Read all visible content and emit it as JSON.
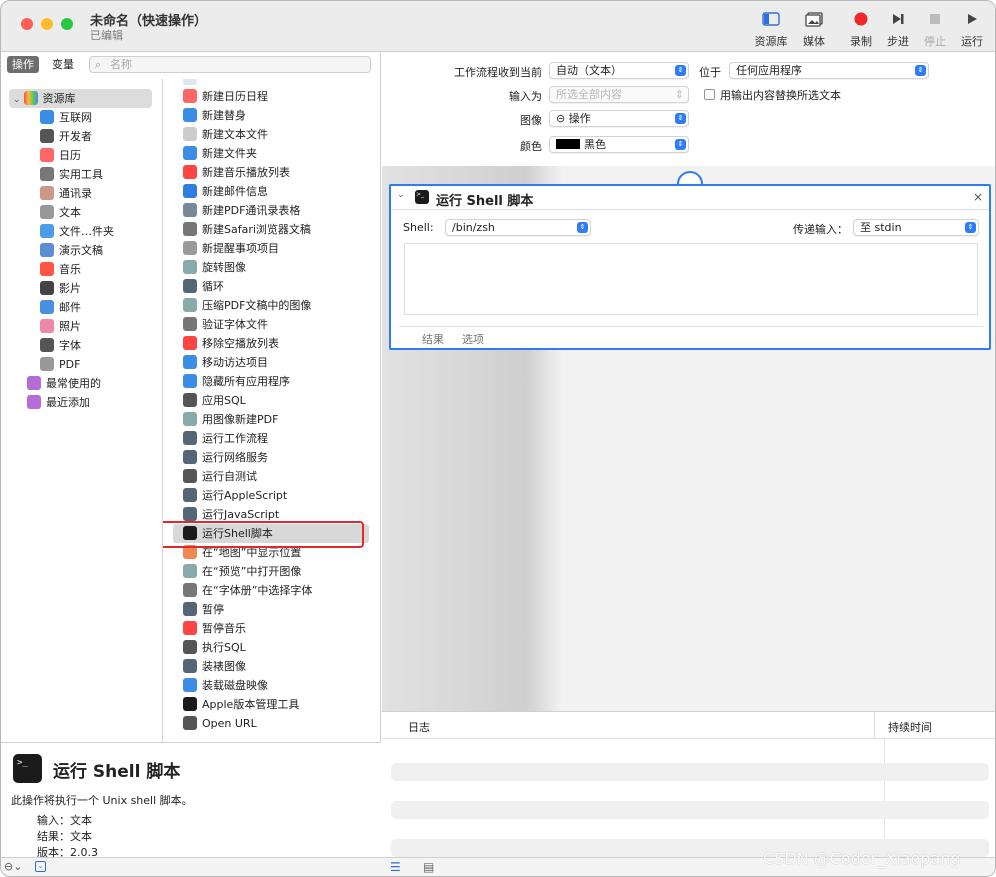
{
  "window": {
    "title": "未命名（快速操作）",
    "subtitle": "已编辑"
  },
  "toolbar": {
    "library": "资源库",
    "media": "媒体",
    "record": "录制",
    "step": "步进",
    "stop": "停止",
    "run": "运行"
  },
  "tabs": {
    "actions": "操作",
    "variables": "变量"
  },
  "search": {
    "placeholder": "名称"
  },
  "library": {
    "root": "资源库",
    "items": [
      "互联网",
      "开发者",
      "日历",
      "实用工具",
      "通讯录",
      "文本",
      "文件…件夹",
      "演示文稿",
      "音乐",
      "影片",
      "邮件",
      "照片",
      "字体",
      "PDF"
    ],
    "most_used": "最常使用的",
    "recent": "最近添加"
  },
  "actions": [
    "新建日历日程",
    "新建替身",
    "新建文本文件",
    "新建文件夹",
    "新建音乐播放列表",
    "新建邮件信息",
    "新建PDF通讯录表格",
    "新建Safari浏览器文稿",
    "新提醒事项项目",
    "旋转图像",
    "循环",
    "压缩PDF文稿中的图像",
    "验证字体文件",
    "移除空播放列表",
    "移动访达项目",
    "隐藏所有应用程序",
    "应用SQL",
    "用图像新建PDF",
    "运行工作流程",
    "运行网络服务",
    "运行自测试",
    "运行AppleScript",
    "运行JavaScript",
    "运行Shell脚本",
    "在“地图”中显示位置",
    "在“预览”中打开图像",
    "在“字体册”中选择字体",
    "暂停",
    "暂停音乐",
    "执行SQL",
    "装裱图像",
    "装载磁盘映像",
    "Apple版本管理工具",
    "Open URL"
  ],
  "info": {
    "title": "运行 Shell 脚本",
    "description": "此操作将执行一个 Unix shell 脚本。",
    "input_label": "输入：",
    "input_value": "文本",
    "result_label": "结果：",
    "result_value": "文本",
    "version_label": "版本：",
    "version_value": "2.0.3"
  },
  "workflow": {
    "receives_label": "工作流程收到当前",
    "receives_value": "自动（文本）",
    "in_label": "位于",
    "in_value": "任何应用程序",
    "input_is_label": "输入为",
    "input_is_value": "所选全部内容",
    "replace_label": "用输出内容替换所选文本",
    "image_label": "图像",
    "image_value": "操作",
    "color_label": "颜色",
    "color_value": "黑色"
  },
  "card": {
    "title": "运行 Shell 脚本",
    "shell_label": "Shell:",
    "shell_value": "/bin/zsh",
    "pass_label": "传递输入：",
    "pass_value": "至 stdin",
    "tab_results": "结果",
    "tab_options": "选项"
  },
  "log": {
    "col_log": "日志",
    "col_duration": "持续时间"
  },
  "watermark": "CSDN @Coder_Xiaopang",
  "colors": {
    "accent": "#2d7cf6",
    "highlight": "#e23030"
  }
}
